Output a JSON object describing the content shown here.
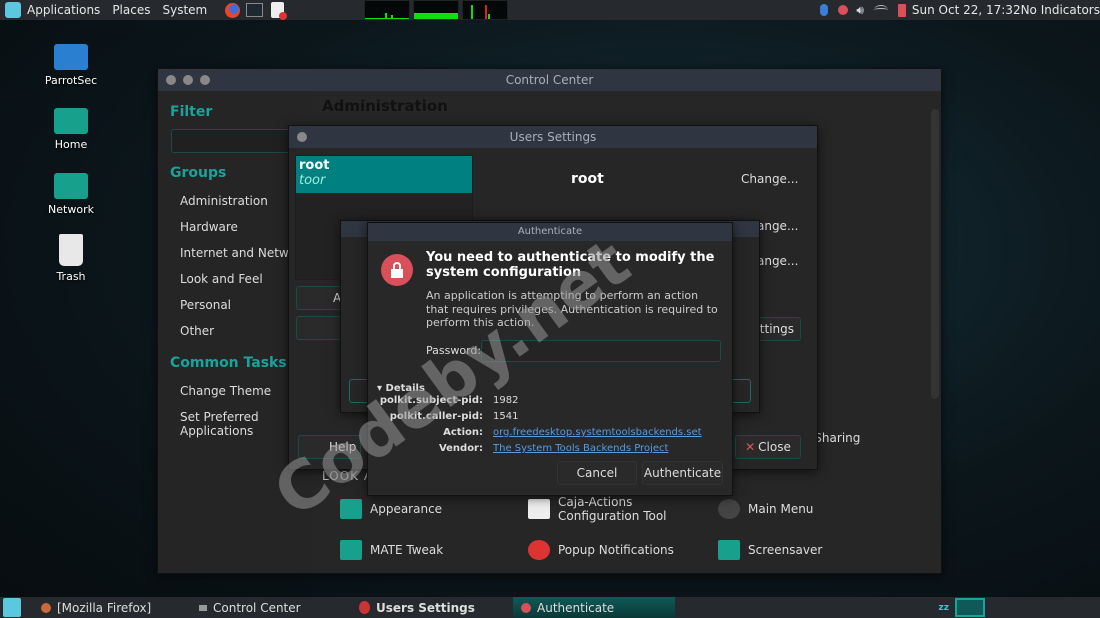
{
  "top_panel": {
    "menus": [
      "Applications",
      "Places",
      "System"
    ],
    "launchers": [
      "firefox-icon",
      "terminal-icon",
      "text-editor-icon"
    ],
    "clock": "Sun Oct 22, 17:32",
    "indicators": "No Indicators",
    "tray": [
      "bluetooth-icon",
      "lock-icon",
      "volume-icon",
      "wifi-icon",
      "battery-icon"
    ]
  },
  "desktop": {
    "icons": [
      {
        "label": "ParrotSec"
      },
      {
        "label": "Home"
      },
      {
        "label": "Network"
      },
      {
        "label": "Trash"
      }
    ]
  },
  "control_center": {
    "title": "Control Center",
    "filter_heading": "Filter",
    "filter_value": "",
    "groups_heading": "Groups",
    "groups": [
      "Administration",
      "Hardware",
      "Internet and Network",
      "Look and Feel",
      "Personal",
      "Other"
    ],
    "tasks_heading": "Common Tasks",
    "tasks": [
      "Change Theme",
      "Set Preferred Applications"
    ],
    "section_admin": "Administration",
    "section_look": "LOOK AND FEEL",
    "sharing": "Desktop Sharing",
    "items": [
      "Appearance",
      "Caja-Actions Configuration Tool",
      "Main Menu",
      "MATE Tweak",
      "Popup Notifications",
      "Screensaver"
    ]
  },
  "users_settings": {
    "title": "Users Settings",
    "user_name": "root",
    "user_full": "toor",
    "detail_name": "root",
    "change": "Change...",
    "add": "Add",
    "settings": "Settings",
    "help": "Help",
    "close": "Close"
  },
  "auth": {
    "title": "Authenticate",
    "heading": "You need to authenticate to modify the system configuration",
    "body": "An application is attempting to perform an action that requires privileges. Authentication is required to perform this action.",
    "password_label": "Password:",
    "password_value": "",
    "details": "Details",
    "rows": [
      {
        "label": "polkit.subject-pid:",
        "value": "1982"
      },
      {
        "label": "polkit.caller-pid:",
        "value": "1541"
      },
      {
        "label": "Action:",
        "value": "org.freedesktop.systemtoolsbackends.set",
        "link": true
      },
      {
        "label": "Vendor:",
        "value": "The System Tools Backends Project",
        "link": true
      }
    ],
    "cancel": "Cancel",
    "authenticate": "Authenticate"
  },
  "taskbar": {
    "items": [
      {
        "label": "[Mozilla Firefox]"
      },
      {
        "label": "Control Center"
      },
      {
        "label": "Users Settings"
      },
      {
        "label": "Authenticate",
        "active": true
      }
    ]
  },
  "watermark": "Codeby.net",
  "colors": {
    "accent": "#008080",
    "lock": "#d9505a",
    "link": "#5a9be0"
  }
}
